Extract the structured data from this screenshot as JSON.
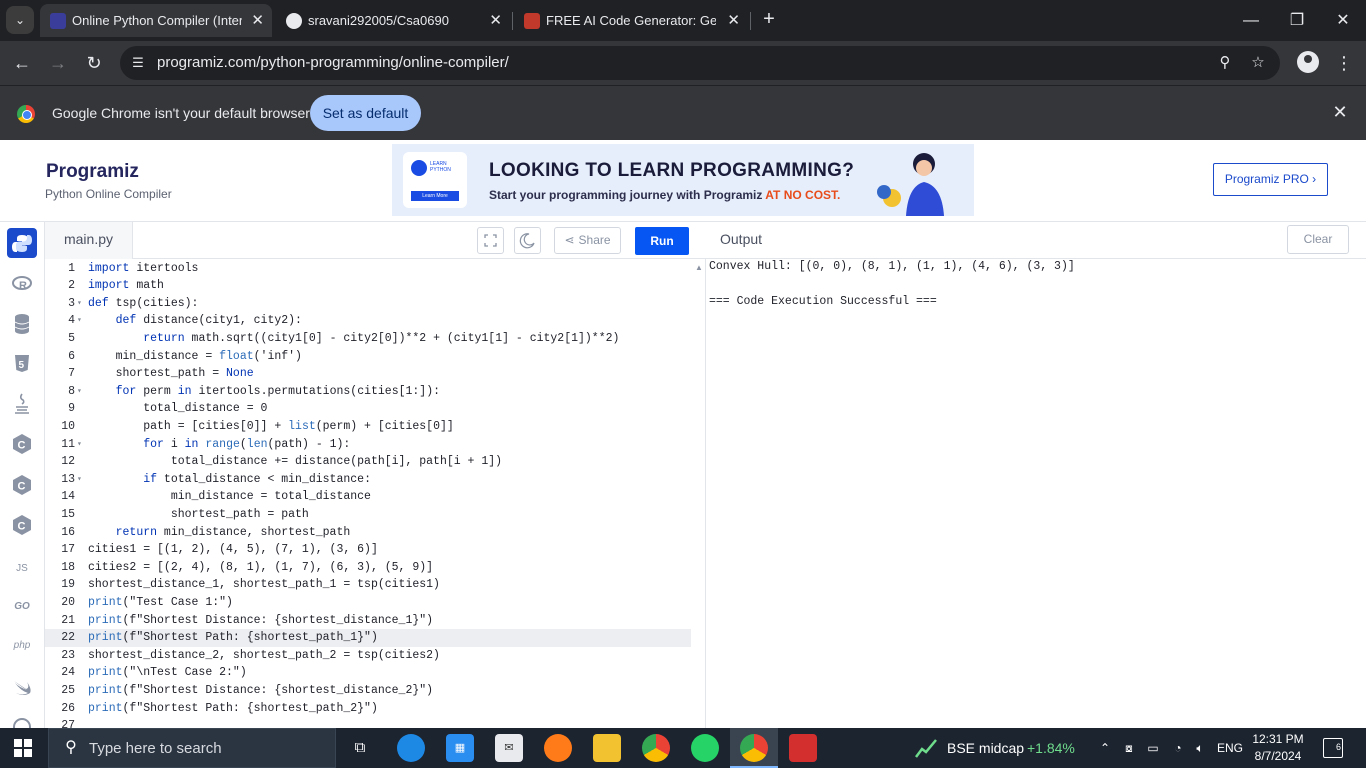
{
  "browser": {
    "tabs": [
      {
        "title": "Online Python Compiler (Interpreter)",
        "active": true
      },
      {
        "title": "sravani292005/Csa0690",
        "active": false
      },
      {
        "title": "FREE AI Code Generator: Generate Code",
        "active": false
      }
    ],
    "url": "programiz.com/python-programming/online-compiler/",
    "infobar": {
      "message": "Google Chrome isn't your default browser",
      "button": "Set as default"
    }
  },
  "site": {
    "logo": "Programiz",
    "subtitle": "Python Online Compiler",
    "banner": {
      "badge_top": "LEARN PYTHON",
      "badge_button": "Learn More",
      "title": "LOOKING TO LEARN PROGRAMMING?",
      "sub_prefix": "Start your programming journey with Programiz ",
      "sub_highlight": "AT NO COST."
    },
    "pro_button": "Programiz PRO ›"
  },
  "rail": {
    "items": [
      "python-icon",
      "r-icon",
      "database-icon",
      "html5-icon",
      "java-icon",
      "c-icon",
      "cpp-icon",
      "csharp-icon",
      "javascript-icon",
      "go-icon",
      "php-icon",
      "swift-icon",
      "rust-icon"
    ],
    "labels": {
      "js": "JS",
      "go": "GO",
      "php": "php"
    }
  },
  "editor": {
    "filename": "main.py",
    "share_label": "Share",
    "run_label": "Run",
    "lines": [
      "import itertools",
      "import math",
      "def tsp(cities):",
      "    def distance(city1, city2):",
      "        return math.sqrt((city1[0] - city2[0])**2 + (city1[1] - city2[1])**2)",
      "    min_distance = float('inf')",
      "    shortest_path = None",
      "    for perm in itertools.permutations(cities[1:]):",
      "        total_distance = 0",
      "        path = [cities[0]] + list(perm) + [cities[0]]",
      "        for i in range(len(path) - 1):",
      "            total_distance += distance(path[i], path[i + 1])",
      "        if total_distance < min_distance:",
      "            min_distance = total_distance",
      "            shortest_path = path",
      "    return min_distance, shortest_path",
      "cities1 = [(1, 2), (4, 5), (7, 1), (3, 6)]",
      "cities2 = [(2, 4), (8, 1), (1, 7), (6, 3), (5, 9)]",
      "shortest_distance_1, shortest_path_1 = tsp(cities1)",
      "print(\"Test Case 1:\")",
      "print(f\"Shortest Distance: {shortest_distance_1}\")",
      "print(f\"Shortest Path: {shortest_path_1}\")",
      "shortest_distance_2, shortest_path_2 = tsp(cities2)",
      "print(\"\\nTest Case 2:\")",
      "print(f\"Shortest Distance: {shortest_distance_2}\")",
      "print(f\"Shortest Path: {shortest_path_2}\")",
      ""
    ],
    "fold_lines": [
      3,
      4,
      8,
      11,
      13
    ],
    "highlight_line": 22
  },
  "output": {
    "title": "Output",
    "clear_label": "Clear",
    "lines": [
      "Convex Hull: [(0, 0), (8, 1), (1, 1), (4, 6), (3, 3)]",
      "",
      "=== Code Execution Successful ==="
    ]
  },
  "taskbar": {
    "search_placeholder": "Type here to search",
    "stock_name": "BSE midcap",
    "stock_change": "+1.84%",
    "language": "ENG",
    "time": "12:31 PM",
    "date": "8/7/2024",
    "notification_count": "6"
  },
  "colors": {
    "accent": "#0556f3",
    "chrome_bg": "#202124",
    "taskbar_bg": "#1c2430",
    "stock_green": "#6fdc8c"
  }
}
